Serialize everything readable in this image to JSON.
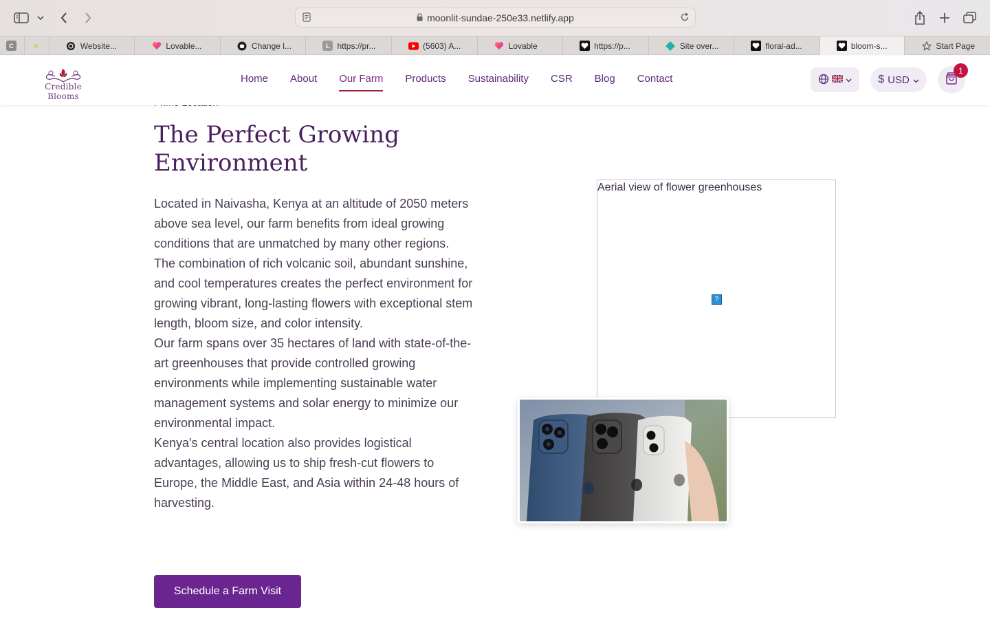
{
  "browser": {
    "url": "moonlit-sundae-250e33.netlify.app",
    "tabs": [
      {
        "label": "",
        "icon": "c-letter-icon",
        "pinned": true
      },
      {
        "label": "",
        "icon": "dot-icon",
        "pinned": true
      },
      {
        "label": "Website...",
        "icon": "openai-icon"
      },
      {
        "label": "Lovable...",
        "icon": "lovable-heart-icon"
      },
      {
        "label": "Change l...",
        "icon": "github-icon"
      },
      {
        "label": "https://pr...",
        "icon": "l-letter-icon"
      },
      {
        "label": "(5603) A...",
        "icon": "youtube-icon"
      },
      {
        "label": "Lovable",
        "icon": "lovable-heart-icon"
      },
      {
        "label": "https://p...",
        "icon": "heart-outline-icon"
      },
      {
        "label": "Site over...",
        "icon": "netlify-diamond-icon"
      },
      {
        "label": "floral-ad...",
        "icon": "heart-outline-icon"
      },
      {
        "label": "bloom-s...",
        "icon": "heart-outline-icon",
        "active": true
      },
      {
        "label": "Start Page",
        "icon": "star-icon"
      }
    ]
  },
  "header": {
    "logo_text": "Credible Blooms",
    "nav": [
      "Home",
      "About",
      "Our Farm",
      "Products",
      "Sustainability",
      "CSR",
      "Blog",
      "Contact"
    ],
    "active_nav": "Our Farm",
    "currency": "USD",
    "cart_count": "1"
  },
  "section": {
    "eyebrow": "Prime Location",
    "title": "The Perfect Growing Environment",
    "paragraphs": [
      "Located in Naivasha, Kenya at an altitude of 2050 meters above sea level, our farm benefits from ideal growing conditions that are unmatched by many other regions.",
      "The combination of rich volcanic soil, abundant sunshine, and cool temperatures creates the perfect environment for growing vibrant, long-lasting flowers with exceptional stem length, bloom size, and color intensity.",
      "Our farm spans over 35 hectares of land with state-of-the-art greenhouses that provide controlled growing environments while implementing sustainable water management systems and solar energy to minimize our environmental impact.",
      "Kenya's central location also provides logistical advantages, allowing us to ship fresh-cut flowers to Europe, the Middle East, and Asia within 24-48 hours of harvesting."
    ],
    "cta": "Schedule a Farm Visit",
    "image_alt": "Aerial view of flower greenhouses"
  },
  "colors": {
    "accent": "#6b2590",
    "nav_text": "#5c2a7a",
    "badge": "#c4133f"
  }
}
